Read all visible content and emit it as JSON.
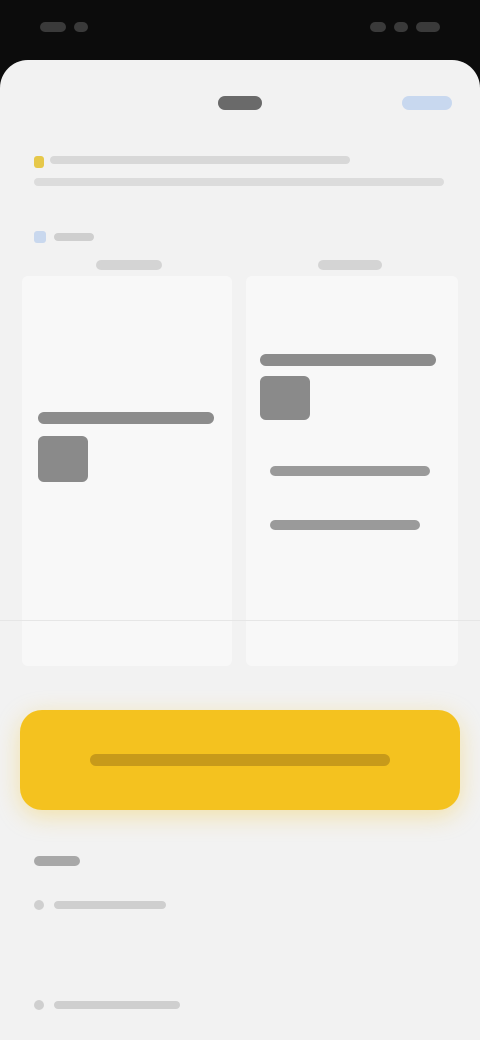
{
  "status_bar": {
    "time": "",
    "right_icons": [
      "signal-icon",
      "wifi-icon",
      "battery-icon"
    ]
  },
  "sheet": {
    "title": "",
    "header_action": ""
  },
  "notice": {
    "text": "",
    "icon": "warning-icon",
    "accent": "#e6c84a"
  },
  "preview": {
    "section_label": "",
    "columns": [
      "",
      ""
    ]
  },
  "cta": {
    "label": "",
    "color": "#f4c21f"
  },
  "more": {
    "heading": "",
    "items": [
      "",
      ""
    ]
  }
}
